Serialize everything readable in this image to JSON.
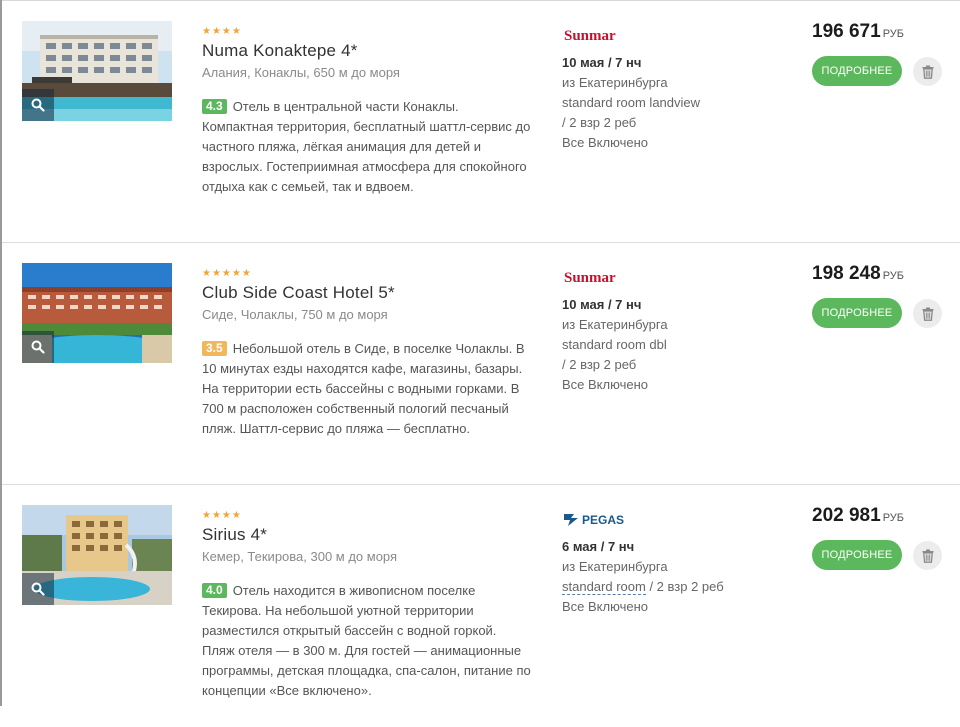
{
  "colors": {
    "accent_green": "#5cb85c",
    "star": "#f0a43a",
    "rating_green": "#5cb85c",
    "rating_orange": "#f0b85a",
    "sunmar_red": "#c8102e",
    "pegas_blue": "#1a5a8a"
  },
  "hotels": [
    {
      "stars": "★★★★",
      "name": "Numa Konaktepe 4*",
      "location": "Алания, Конаклы, 650 м до моря",
      "rating": "4.3",
      "description": "Отель в центральной части Конаклы. Компактная территория, бесплатный шаттл-сервис до частного пляжа, лёгкая анимация для детей и взрослых. Гостеприимная атмосфера для спокойного отдыха как с семьей, так и вдвоем.",
      "operator": "Sunmar",
      "date": "10 мая / 7 нч",
      "departure": "из Екатеринбурга",
      "room": "standard room landview",
      "guests": " / 2 взр 2 реб",
      "meal": "Все Включено",
      "price": "196 671",
      "currency": "РУБ",
      "details_label": "ПОДРОБНЕЕ"
    },
    {
      "stars": "★★★★★",
      "name": "Club Side Coast Hotel 5*",
      "location": "Сиде, Чолаклы, 750 м до моря",
      "rating": "3.5",
      "description": "Небольшой отель в Сиде, в поселке Чолаклы. В 10 минутах езды находятся кафе, магазины, базары. На территории есть бассейны с водными горками. В 700 м расположен собственный пологий песчаный пляж. Шаттл-сервис до пляжа — бесплатно.",
      "operator": "Sunmar",
      "date": "10 мая / 7 нч",
      "departure": "из Екатеринбурга",
      "room": "standard room dbl",
      "guests": " / 2 взр 2 реб",
      "meal": "Все Включено",
      "price": "198 248",
      "currency": "РУБ",
      "details_label": "ПОДРОБНЕЕ"
    },
    {
      "stars": "★★★★",
      "name": "Sirius 4*",
      "location": "Кемер, Текирова, 300 м до моря",
      "rating": "4.0",
      "description": "Отель находится в живописном поселке Текирова. На небольшой уютной территории разместился открытый бассейн с водной горкой. Пляж отеля — в 300 м. Для гостей — анимационные программы, детская площадка, спа-салон, питание по концепции «Все включено».",
      "operator": "PEGAS",
      "date": "6 мая / 7 нч",
      "departure": "из Екатеринбурга",
      "room": "standard room",
      "guests": " / 2 взр 2 реб",
      "meal": "Все Включено",
      "price": "202 981",
      "currency": "РУБ",
      "details_label": "ПОДРОБНЕЕ"
    }
  ]
}
